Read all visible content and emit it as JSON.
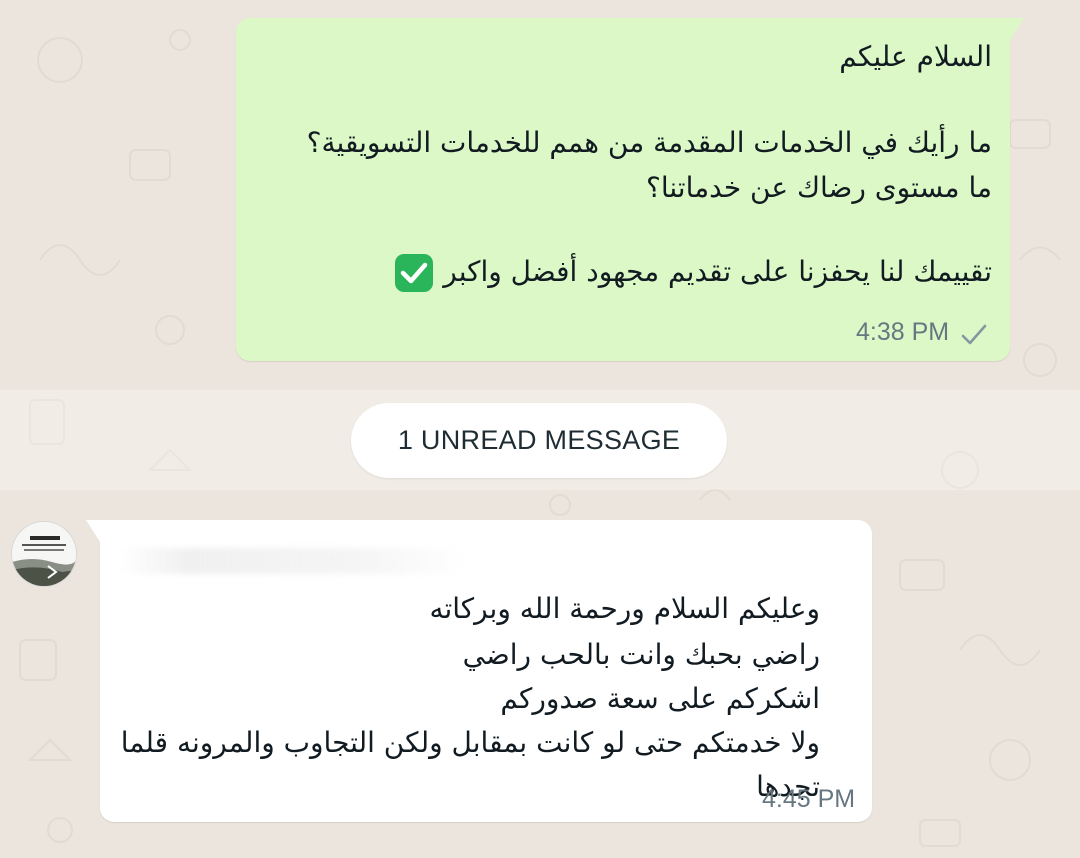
{
  "outgoing_message": {
    "lines": [
      "السلام عليكم",
      "ما رأيك في الخدمات المقدمة من همم للخدمات التسويقية؟",
      "ما مستوى رضاك عن خدماتنا؟",
      "تقييمك لنا يحفزنا على تقديم مجهود أفضل واكبر"
    ],
    "time": "4:38 PM",
    "status_icon": "single-check-icon",
    "emoji_icon": "check-mark-button-icon"
  },
  "divider": {
    "unread_label": "1 UNREAD MESSAGE"
  },
  "incoming_message": {
    "lines": [
      "وعليكم السلام ورحمة الله وبركاته",
      "راضي بحبك وانت بالحب راضي",
      "اشكركم على سعة صدوركم",
      "ولا خدمتكم حتى لو كانت بمقابل ولكن التجاوب والمرونه قلما",
      "تجدها"
    ],
    "time": "4:45 PM",
    "avatar_icon": "profile-avatar-icon"
  },
  "colors": {
    "chat_background": "#ece5dd",
    "outgoing_bubble": "#dcf8c6",
    "incoming_bubble": "#ffffff",
    "meta_text": "#667781",
    "emoji_green": "#2bb55a"
  }
}
